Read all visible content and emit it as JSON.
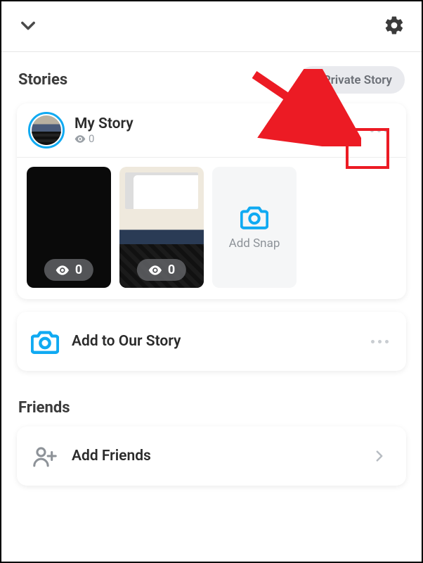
{
  "header": {},
  "sections": {
    "stories": {
      "title": "Stories",
      "private_btn": "Private Story",
      "my_story": {
        "title": "My Story",
        "views": "0"
      },
      "snaps": [
        {
          "views": "0"
        },
        {
          "views": "0"
        }
      ],
      "add_snap_label": "Add Snap",
      "our_story": {
        "title": "Add to Our Story"
      }
    },
    "friends": {
      "title": "Friends",
      "add_friends": {
        "title": "Add Friends"
      }
    }
  },
  "colors": {
    "accent": "#10aaf2"
  }
}
